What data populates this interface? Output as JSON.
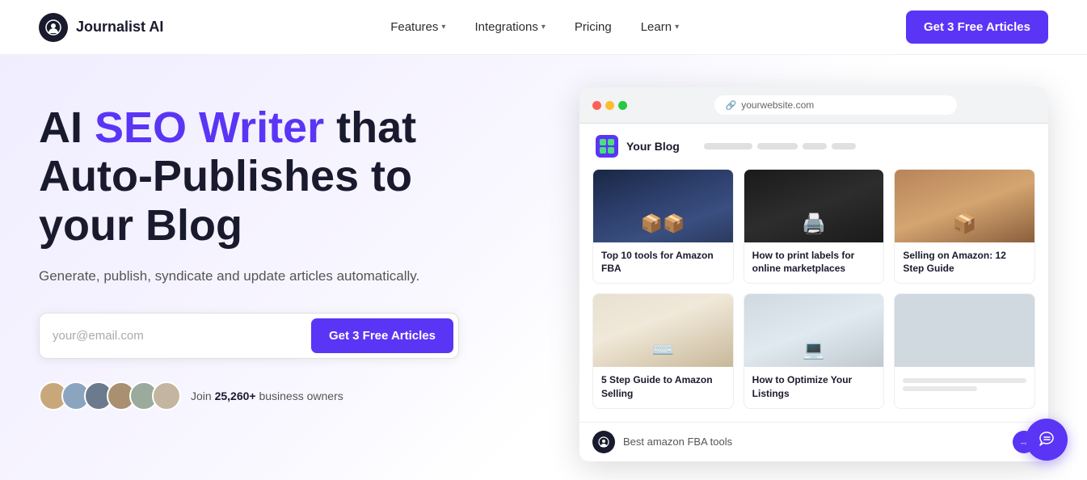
{
  "nav": {
    "logo_text": "Journalist AI",
    "links": [
      {
        "label": "Features",
        "has_dropdown": true
      },
      {
        "label": "Integrations",
        "has_dropdown": true
      },
      {
        "label": "Pricing",
        "has_dropdown": false
      },
      {
        "label": "Learn",
        "has_dropdown": true
      }
    ],
    "cta_label": "Get 3 Free Articles"
  },
  "hero": {
    "headline_plain": "AI ",
    "headline_purple": "SEO Writer",
    "headline_plain2": " that Auto-Publishes to your Blog",
    "subtext": "Generate, publish, syndicate and update articles automatically.",
    "email_placeholder": "your@email.com",
    "cta_label": "Get 3 Free Articles",
    "social_proof_text": "Join ",
    "social_proof_bold": "25,260+",
    "social_proof_text2": " business owners"
  },
  "browser": {
    "url": "yourwebsite.com",
    "blog_title": "Your Blog",
    "articles": [
      {
        "title": "Top 10 tools for Amazon FBA",
        "img_type": "amazon-boxes"
      },
      {
        "title": "How to print labels for online marketplaces",
        "img_type": "printer"
      },
      {
        "title": "Selling on Amazon: 12 Step Guide",
        "img_type": "delivery"
      },
      {
        "title": "5 Step Guide to Amazon Selling",
        "img_type": "laptop-hands"
      },
      {
        "title": "How to Optimize Your Listings",
        "img_type": "laptop2"
      },
      {
        "title": "",
        "img_type": "placeholder"
      }
    ],
    "chat_placeholder": "Best amazon FBA tools",
    "chat_send_label": "→"
  },
  "chat_bubble": {
    "icon": "✎"
  }
}
